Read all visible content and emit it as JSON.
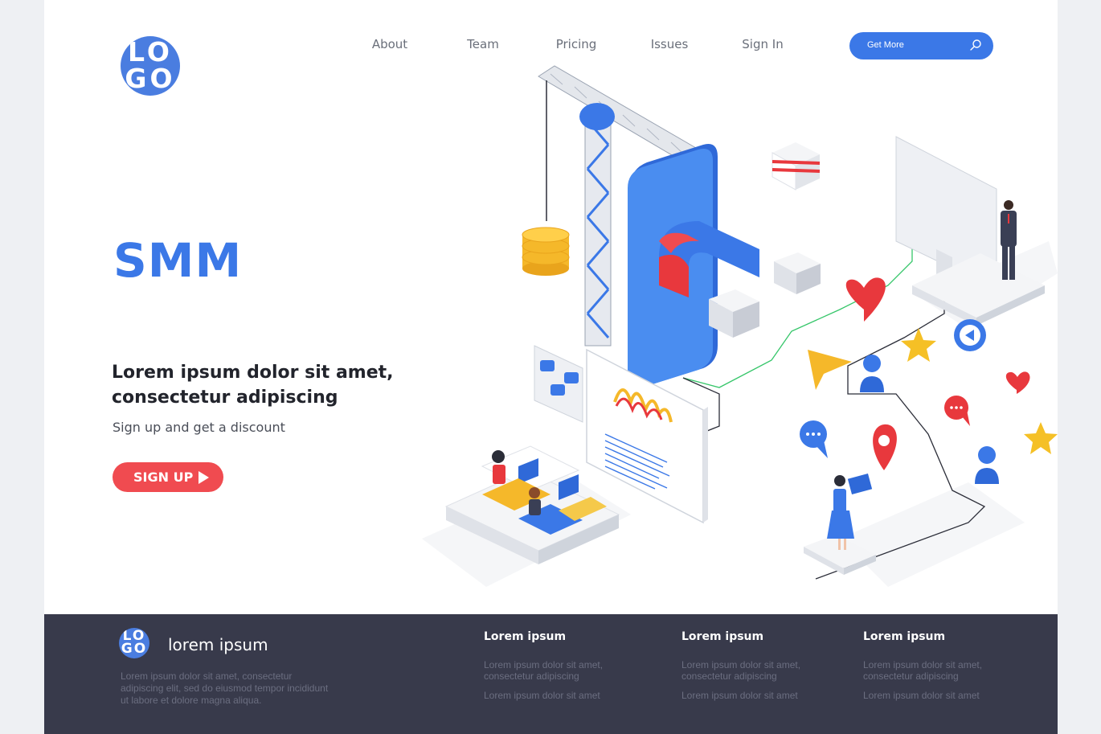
{
  "header": {
    "logo_top": "LO",
    "logo_bottom": "GO",
    "nav": [
      "About",
      "Team",
      "Pricing",
      "Issues",
      "Sign In"
    ],
    "search_label": "Get More",
    "search_icon": "search-icon"
  },
  "hero": {
    "title": "SMM",
    "headline": "Lorem ipsum dolor sit amet, consectetur adipiscing",
    "subtitle": "Sign up and get a discount",
    "cta_label": "SIGN UP",
    "cta_icon": "play-arrow-icon"
  },
  "footer": {
    "logo_top": "LO",
    "logo_bottom": "GO",
    "brand": "lorem ipsum",
    "description": "Lorem ipsum dolor sit amet, consectetur adipiscing elit, sed do eiusmod tempor incididunt ut labore et dolore magna aliqua.",
    "columns": [
      {
        "title": "Lorem ipsum",
        "line1": "Lorem ipsum dolor sit amet, consectetur adipiscing",
        "line2": "Lorem ipsum dolor sit amet"
      },
      {
        "title": "Lorem ipsum",
        "line1": "Lorem ipsum dolor sit amet, consectetur adipiscing",
        "line2": "Lorem ipsum dolor sit amet"
      },
      {
        "title": "Lorem ipsum",
        "line1": "Lorem ipsum dolor sit amet, consectetur adipiscing",
        "line2": "Lorem ipsum dolor sit amet"
      }
    ]
  },
  "colors": {
    "primary_blue": "#3b78e7",
    "accent_red": "#f04b50",
    "footer_bg": "#383a4b",
    "coin_gold": "#f5b82a"
  }
}
